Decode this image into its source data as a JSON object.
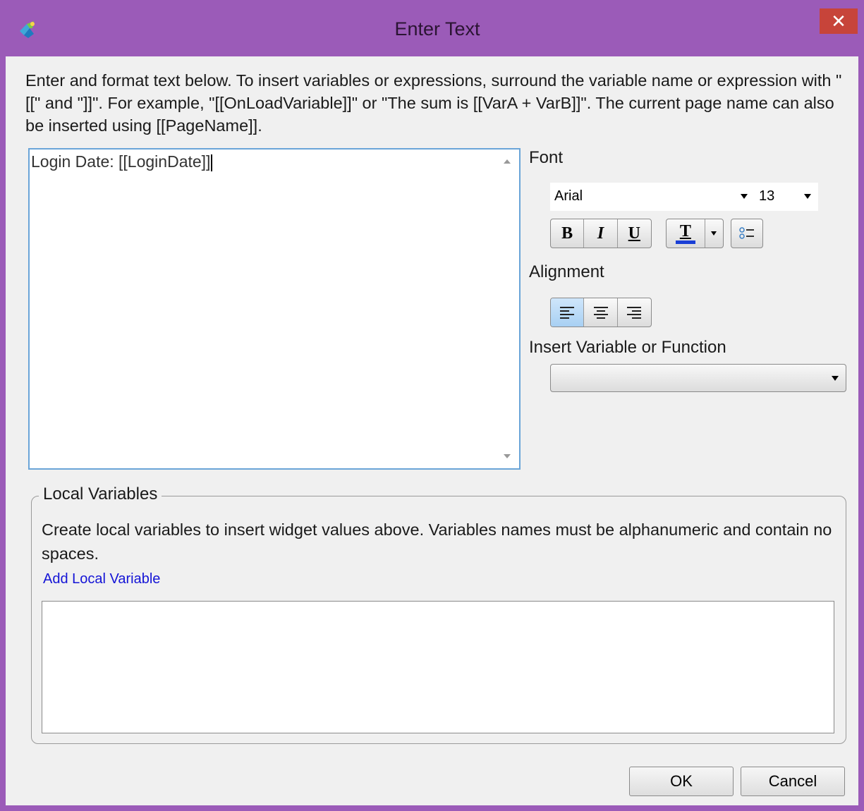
{
  "window": {
    "title": "Enter Text",
    "close_glyph": "✕",
    "icon": "app-logo-icon"
  },
  "instructions": "Enter and format text below. To insert variables or expressions, surround the variable name or expression with \"[[\" and \"]]\". For example, \"[[OnLoadVariable]]\" or \"The sum is [[VarA + VarB]]\". The current page name can also be inserted using [[PageName]].",
  "editor": {
    "content": "Login Date: [[LoginDate]]"
  },
  "font": {
    "label": "Font",
    "family": "Arial",
    "size": "13",
    "bold_label": "B",
    "italic_label": "I",
    "underline_label": "U",
    "text_color_label": "T",
    "text_color": "#1a3fd6"
  },
  "alignment": {
    "label": "Alignment",
    "selected": "left"
  },
  "insert": {
    "label": "Insert Variable or Function",
    "value": ""
  },
  "local_variables": {
    "title": "Local Variables",
    "description": "Create local variables to insert widget values above. Variables names must be alphanumeric and contain no spaces.",
    "add_link": "Add Local Variable"
  },
  "buttons": {
    "ok": "OK",
    "cancel": "Cancel"
  },
  "colors": {
    "frame": "#9b5bb8",
    "close": "#c7443a",
    "focus_border": "#6aa5d8",
    "link": "#1414d6"
  }
}
